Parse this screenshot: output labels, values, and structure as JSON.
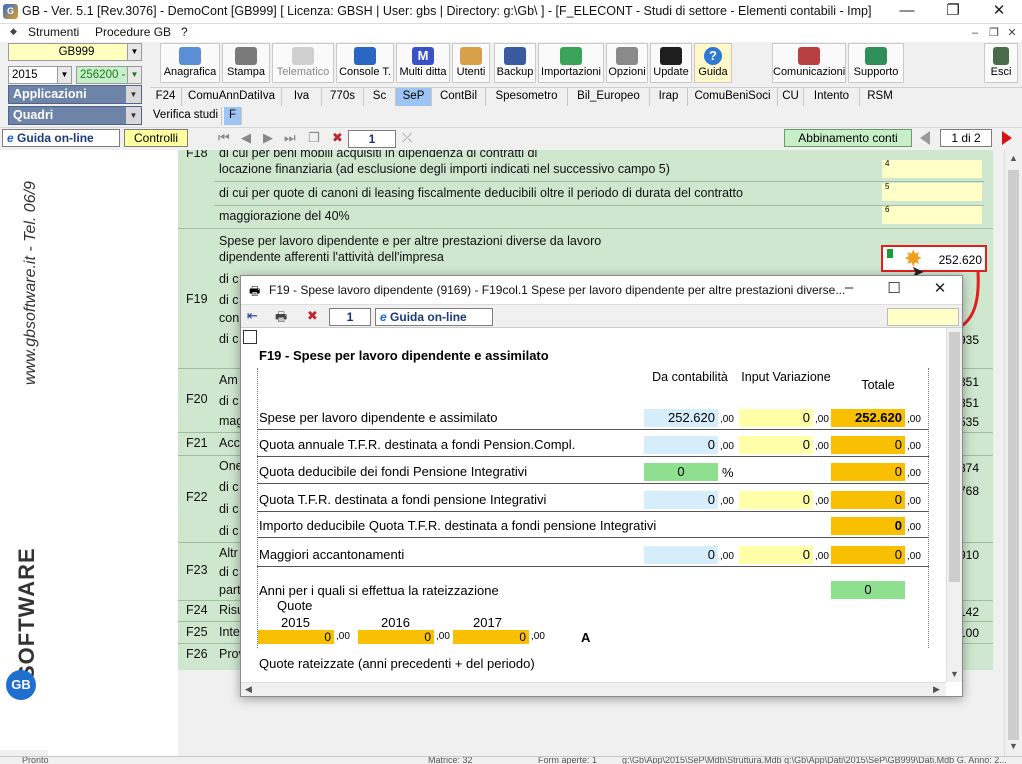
{
  "window": {
    "title": "GB - Ver. 5.1 [Rev.3076] - DemoCont [GB999]  [ Licenza: GBSH | User: gbs | Directory: g:\\Gb\\ ] - [F_ELECONT - Studi di settore - Elementi contabili - Imp]",
    "min": "—",
    "max": "❐",
    "close": "✕"
  },
  "menu": {
    "items": [
      "Strumenti",
      "Procedure GB",
      "?"
    ]
  },
  "selectors": {
    "company": "GB999",
    "year": "2015",
    "code": "256200 -",
    "applicazioni": "Applicazioni",
    "quadri": "Quadri"
  },
  "toolbar": {
    "buttons": [
      "Anagrafica",
      "Stampa",
      "Telematico",
      "Console T.",
      "Multi ditta",
      "Utenti",
      "Backup",
      "Importazioni",
      "Opzioni",
      "Update",
      "Guida",
      "Comunicazioni",
      "Supporto",
      "Esci"
    ]
  },
  "tabs": {
    "row1": [
      "F24",
      "ComuAnnDatiIva",
      "Iva",
      "770s",
      "Sc",
      "SeP",
      "ContBil",
      "Spesometro",
      "Bil_Europeo",
      "Irap",
      "ComuBeniSoci",
      "CU",
      "Intento",
      "RSM"
    ],
    "row2": [
      "Verifica studi",
      "F"
    ]
  },
  "controlbar": {
    "guida_online": "Guida on-line",
    "controlli": "Controlli",
    "page_num": "1",
    "abbinamento": "Abbinamento conti",
    "page_of": "1 di 2"
  },
  "sidelogo": {
    "url": "www.gbsoftware.it - Tel. 06/9",
    "brand": "SOFTWARE",
    "brand_prefix": "GB"
  },
  "form": {
    "rows": [
      {
        "code": "F18",
        "text": "di cui per beni mobili acquisiti in dipendenza di contratti di"
      },
      {
        "text": "locazione finanziaria (ad esclusione degli importi indicati nel successivo campo 5)",
        "col": "4"
      },
      {
        "text": "di cui per quote di canoni di leasing fiscalmente deducibili oltre il periodo di durata del contratto",
        "col": "5"
      },
      {
        "text": "maggiorazione del 40%",
        "col": "6"
      },
      {
        "text": "Spese per lavoro dipendente e per altre prestazioni diverse da lavoro"
      },
      {
        "text": "dipendente afferenti l'attività dell'impresa",
        "col": "1",
        "value": "252.620"
      }
    ],
    "codes": [
      "F19",
      "F20",
      "F21",
      "F22",
      "F23",
      "F24",
      "F25",
      "F26"
    ],
    "partial": [
      "di c",
      "di c",
      "con",
      "di c",
      "Am",
      "di c",
      "mag",
      "Acc",
      "One",
      "di c",
      "di c",
      "di c",
      "Altr",
      "di c",
      "part",
      "Risu",
      "Inte",
      "Prov"
    ],
    "right_values": [
      "935",
      "851",
      "851",
      "535",
      "874",
      "768",
      "910",
      "142",
      "100"
    ]
  },
  "modal": {
    "title": "F19 - Spese lavoro dipendente (9169) - F19col.1 Spese per lavoro dipendente per altre prestazioni diverse...",
    "page": "1",
    "guida": "Guida on-line",
    "section_title": "F19 - Spese per lavoro dipendente e assimilato",
    "columns": [
      "Da contabilità",
      "Input Variazione",
      "Totale"
    ],
    "dec": ",00",
    "percent": "%",
    "rows": [
      {
        "label": "Spese per lavoro dipendente e assimilato",
        "a": "252.620",
        "b": "0",
        "t": "252.620"
      },
      {
        "label": "Quota annuale T.F.R. destinata a fondi Pension.Compl.",
        "a": "0",
        "b": "0",
        "t": "0"
      },
      {
        "label": "Quota deducibile dei fondi Pensione Integrativi",
        "pct": "0",
        "t": "0"
      },
      {
        "label": "Quota T.F.R. destinata a fondi pensione Integrativi",
        "a": "0",
        "b": "0",
        "t": "0"
      },
      {
        "label": "Importo deducibile Quota T.F.R. destinata a fondi pensione Integrativi",
        "t": "0"
      },
      {
        "label": "Maggiori accantonamenti",
        "a": "0",
        "b": "0",
        "t": "0"
      },
      {
        "label": "Anni per i quali si effettua la rateizzazione",
        "g": "0"
      }
    ],
    "quote_label": "Quote",
    "years": [
      "2015",
      "2016",
      "2017"
    ],
    "quote_values": [
      "0",
      "0",
      "0"
    ],
    "quote_marker": "A",
    "last_label": "Quote rateizzate  (anni precedenti + del periodo)"
  },
  "status": {
    "items": [
      "Pronto",
      "Matrice: 32",
      "Form aperte: 1",
      "g:\\Gb\\App\\2015\\SeP\\Mdb\\Struttura.Mdb g:\\Gb\\App\\Dati\\2015\\SeP\\GB999\\Dati.Mdb G. Anno: 2..."
    ]
  }
}
